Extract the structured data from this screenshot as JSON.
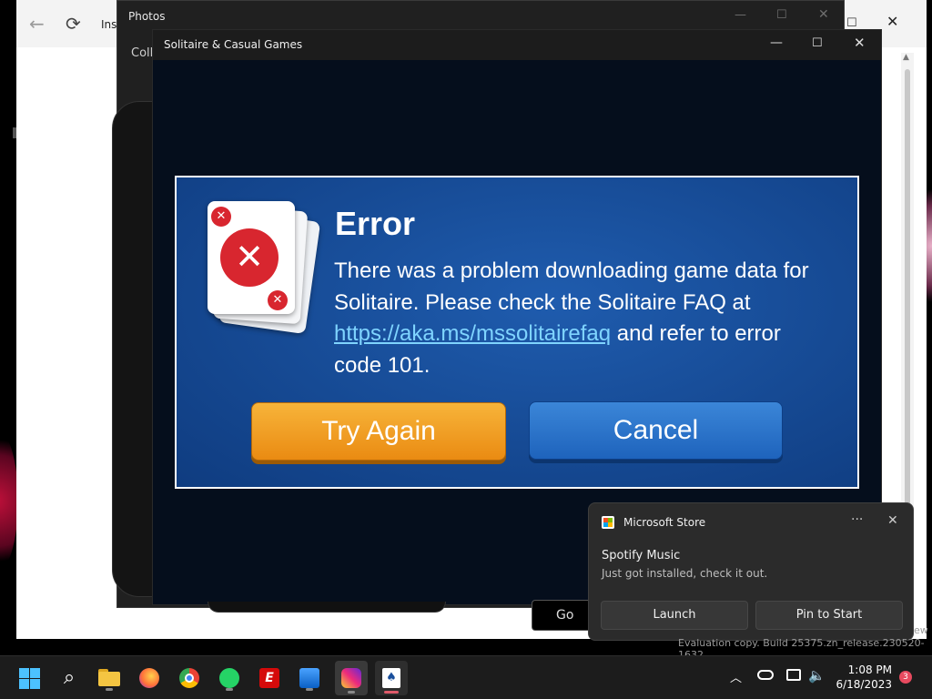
{
  "background_window": {
    "title": "Ins",
    "back_icon": "back-arrow-icon",
    "refresh_icon": "refresh-icon",
    "maximize_icon": "maximize-icon",
    "close_icon": "close-icon"
  },
  "photos_window": {
    "title": "Photos",
    "nav_label": "Coll"
  },
  "solitaire_window": {
    "title": "Solitaire & Casual Games",
    "play_store_label": "Go"
  },
  "error_dialog": {
    "title": "Error",
    "message_pre": "There was a problem downloading game data for Solitaire. Please check the Solitaire FAQ at ",
    "link_text": "https://aka.ms/mssolitairefaq",
    "message_post": " and refer to error code 101.",
    "try_again_label": "Try Again",
    "cancel_label": "Cancel",
    "icon": "error-cards-icon",
    "accent_color": "#d8262f"
  },
  "toast": {
    "app_name": "Microsoft Store",
    "more_label": "···",
    "close_label": "✕",
    "headline": "Spotify Music",
    "body": "Just got installed, check it out.",
    "launch_label": "Launch",
    "pin_label": "Pin to Start"
  },
  "watermark": {
    "text": "Evaluation copy. Build 25375.zn_release.230520-1632",
    "text2": "ew"
  },
  "taskbar": {
    "apps": [
      "start",
      "search",
      "file-explorer",
      "firefox",
      "chrome",
      "whatsapp",
      "espn",
      "photos",
      "instagram",
      "solitaire"
    ],
    "espn_label": "E",
    "time": "1:08 PM",
    "date": "6/18/2023",
    "notification_count": "3"
  }
}
